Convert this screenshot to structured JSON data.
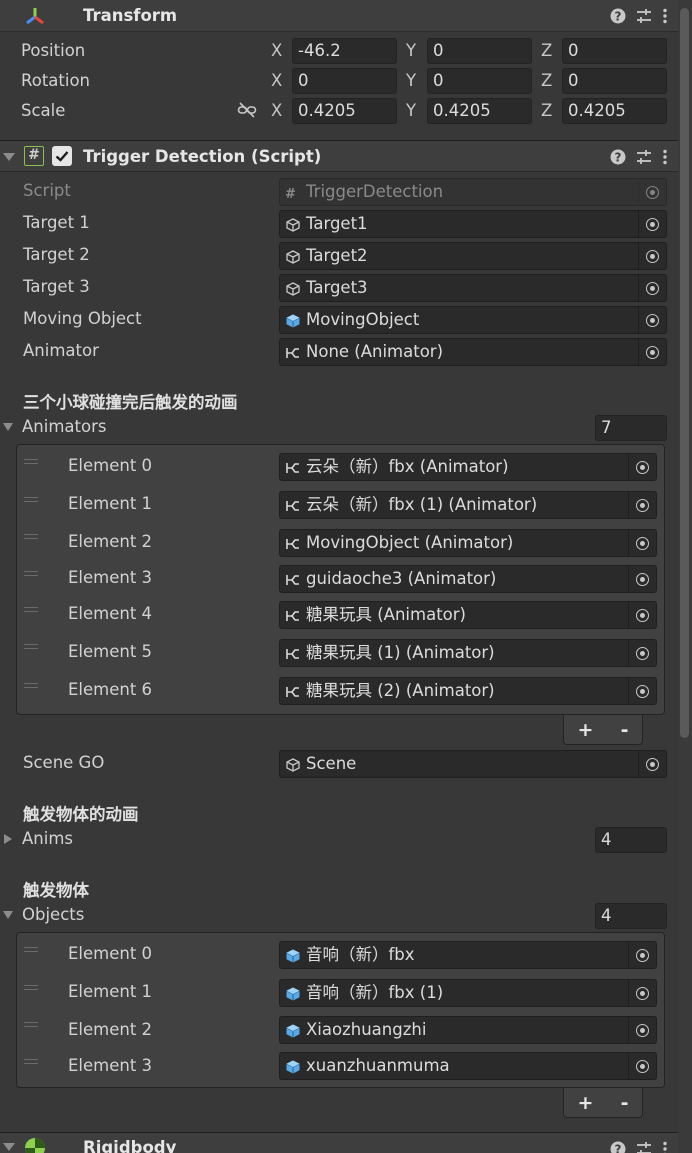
{
  "transform": {
    "title": "Transform",
    "rows": [
      {
        "label": "Position",
        "x": "-46.2",
        "y": "0",
        "z": "0"
      },
      {
        "label": "Rotation",
        "x": "0",
        "y": "0",
        "z": "0"
      },
      {
        "label": "Scale",
        "x": "0.4205",
        "y": "0.4205",
        "z": "0.4205"
      }
    ],
    "axis_x": "X",
    "axis_y": "Y",
    "axis_z": "Z"
  },
  "script": {
    "title": "Trigger Detection (Script)",
    "script_label": "Script",
    "script_value": "TriggerDetection",
    "fields": [
      {
        "label": "Target 1",
        "value": "Target1",
        "icon": "gameobject-icon"
      },
      {
        "label": "Target 2",
        "value": "Target2",
        "icon": "gameobject-icon"
      },
      {
        "label": "Target 3",
        "value": "Target3",
        "icon": "gameobject-icon"
      },
      {
        "label": "Moving Object",
        "value": "MovingObject",
        "icon": "prefab-icon"
      },
      {
        "label": "Animator",
        "value": "None (Animator)",
        "icon": "animator-icon"
      }
    ],
    "animators_header": "三个小球碰撞完后触发的动画",
    "animators_label": "Animators",
    "animators_size": "7",
    "animators": [
      {
        "label": "Element 0",
        "value": "云朵（新）fbx (Animator)"
      },
      {
        "label": "Element 1",
        "value": "云朵（新）fbx (1) (Animator)"
      },
      {
        "label": "Element 2",
        "value": "MovingObject (Animator)"
      },
      {
        "label": "Element 3",
        "value": "guidaoche3 (Animator)"
      },
      {
        "label": "Element 4",
        "value": "糖果玩具 (Animator)"
      },
      {
        "label": "Element 5",
        "value": "糖果玩具 (1) (Animator)"
      },
      {
        "label": "Element 6",
        "value": "糖果玩具 (2) (Animator)"
      }
    ],
    "plus": "+",
    "minus": "-",
    "scene_label": "Scene GO",
    "scene_value": "Scene",
    "anims_header": "触发物体的动画",
    "anims_label": "Anims",
    "anims_size": "4",
    "objects_header": "触发物体",
    "objects_label": "Objects",
    "objects_size": "4",
    "objects": [
      {
        "label": "Element 0",
        "value": "音响（新）fbx"
      },
      {
        "label": "Element 1",
        "value": "音响（新）fbx (1)"
      },
      {
        "label": "Element 2",
        "value": "Xiaozhuangzhi"
      },
      {
        "label": "Element 3",
        "value": "xuanzhuanmuma"
      }
    ]
  },
  "rigidbody": {
    "title": "Rigidbody"
  },
  "colors": {
    "panel": "#383838",
    "header": "#3e3e3e",
    "field": "#2a2a2a",
    "list": "#414141",
    "prefab_blue": "#5aa9e6"
  }
}
